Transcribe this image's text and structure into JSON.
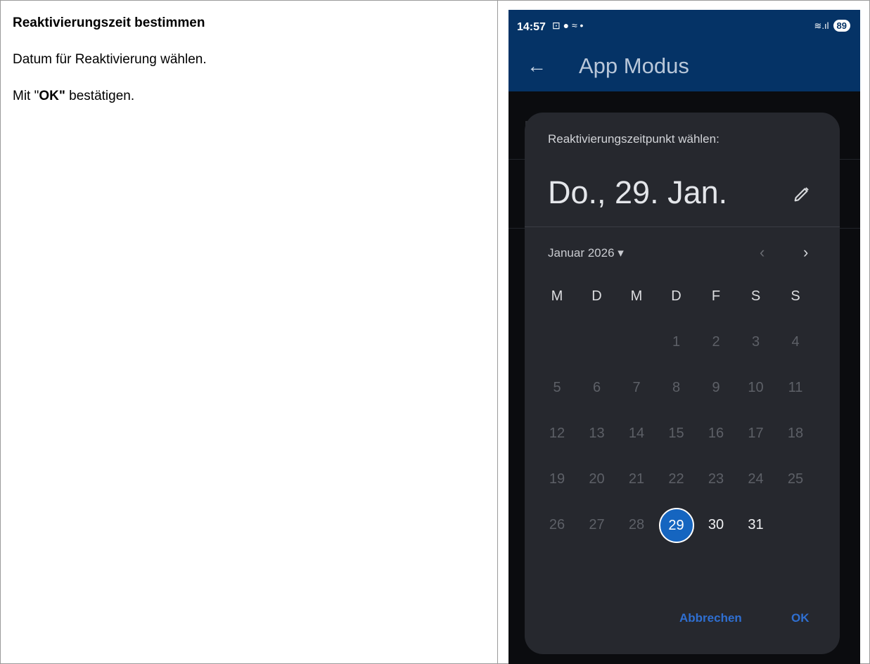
{
  "instructions": {
    "heading": "Reaktivierungszeit bestimmen",
    "step1": "Datum für Reaktivierung wählen.",
    "step2_prefix": "Mit \"",
    "step2_bold": "OK\"",
    "step2_suffix": " bestätigen."
  },
  "status_bar": {
    "time": "14:57",
    "icons": "⊡ ● ≈ •",
    "signal": "≋.ıl",
    "battery": "89"
  },
  "app_bar": {
    "back_icon": "←",
    "title": "App Modus"
  },
  "dialog": {
    "label": "Reaktivierungszeitpunkt wählen:",
    "selected_date": "Do., 29. Jan.",
    "month_year": "Januar 2026",
    "dropdown_icon": "▾",
    "prev_icon": "‹",
    "next_icon": "›",
    "weekdays": [
      "M",
      "D",
      "M",
      "D",
      "F",
      "S",
      "S"
    ],
    "weeks": [
      [
        "",
        "",
        "",
        "1",
        "2",
        "3",
        "4"
      ],
      [
        "5",
        "6",
        "7",
        "8",
        "9",
        "10",
        "11"
      ],
      [
        "12",
        "13",
        "14",
        "15",
        "16",
        "17",
        "18"
      ],
      [
        "19",
        "20",
        "21",
        "22",
        "23",
        "24",
        "25"
      ],
      [
        "26",
        "27",
        "28",
        "29",
        "30",
        "31",
        ""
      ]
    ],
    "selected_day": "29",
    "enabled_days": [
      "30",
      "31"
    ],
    "cancel_label": "Abbrechen",
    "ok_label": "OK"
  },
  "colors": {
    "app_bar": "#053366",
    "dialog_bg": "#26282e",
    "accent": "#1565c0",
    "button_text": "#2f6fd1"
  }
}
